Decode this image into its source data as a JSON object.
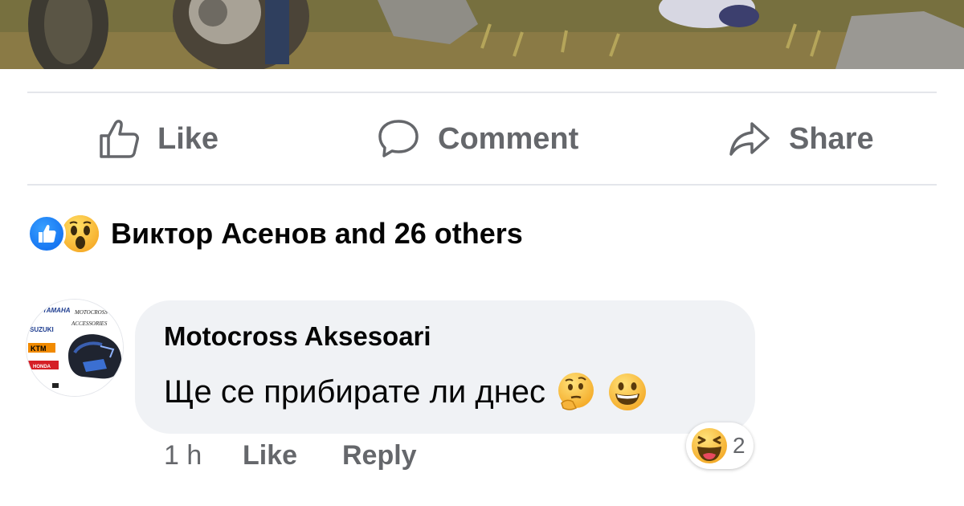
{
  "actions": {
    "like_label": "Like",
    "comment_label": "Comment",
    "share_label": "Share"
  },
  "reactions_summary": {
    "text": "Виктор Асенов and 26 others",
    "icons": [
      "like-reaction-icon",
      "wow-reaction-icon"
    ]
  },
  "comment": {
    "author": "Motocross Aksesoari",
    "text": "Ще се прибирате ли днес",
    "inline_emojis": [
      "thinking-face-emoji",
      "grinning-face-emoji"
    ],
    "time": "1 h",
    "like_label": "Like",
    "reply_label": "Reply",
    "reaction": {
      "icon": "laughing-face-emoji",
      "count": "2"
    },
    "avatar_text": {
      "brands": [
        "YAMAHA",
        "SUZUKI",
        "KTM",
        "HONDA"
      ],
      "logo_line1": "MOTOCROSS",
      "logo_line2": "ACCESSORIES"
    }
  },
  "colors": {
    "secondary_text": "#65676b",
    "bubble_bg": "#f0f2f5",
    "like_blue": "#1877f2",
    "divider": "#e4e6eb"
  }
}
